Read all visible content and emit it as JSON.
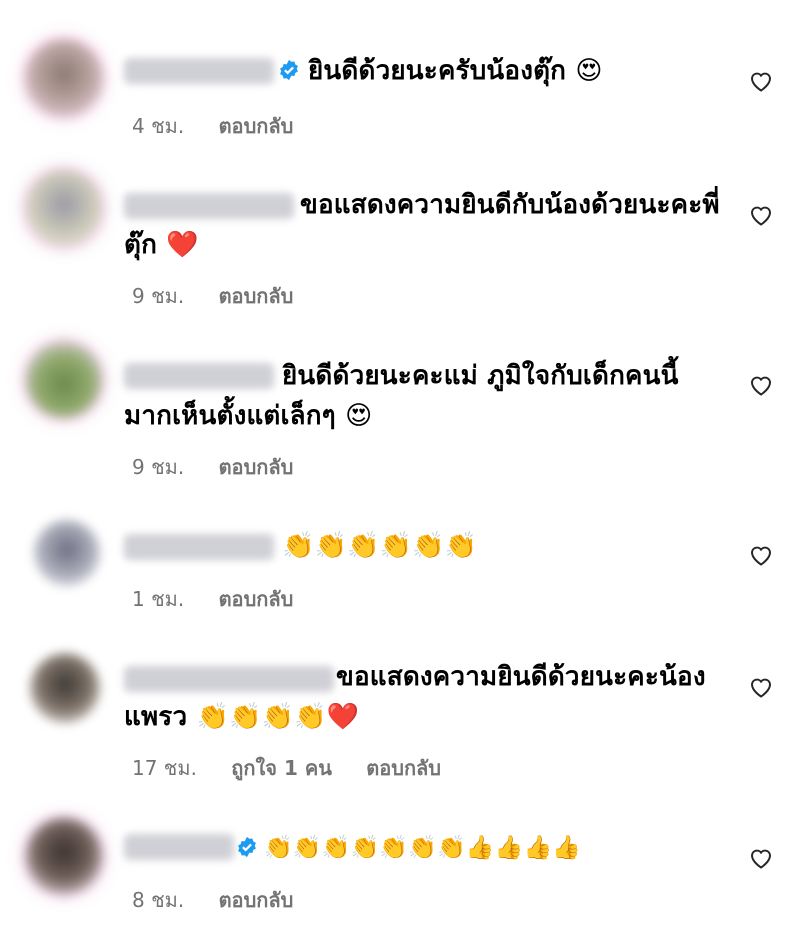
{
  "comments": [
    {
      "text": "ยินดีด้วยนะครับน้องตุ๊ก 😍",
      "time": "4 ชม.",
      "likes": "",
      "reply": "ตอบกลับ"
    },
    {
      "text": "ขอแสดงความยินดีกับน้องด้วยนะคะพี่ตุ๊ก ❤️",
      "time": "9 ชม.",
      "likes": "",
      "reply": "ตอบกลับ"
    },
    {
      "text": "ยินดีด้วยนะคะแม่ ภูมิใจกับเด็กคนนี้มากเห็นตั้งแต่เล็กๆ 😍",
      "time": "9 ชม.",
      "likes": "",
      "reply": "ตอบกลับ"
    },
    {
      "text": "👏👏👏👏👏👏",
      "time": "1 ชม.",
      "likes": "",
      "reply": "ตอบกลับ"
    },
    {
      "text": "ขอแสดงความยินดีด้วยนะคะน้องแพรว 👏👏👏👏❤️",
      "time": "17 ชม.",
      "likes": "ถูกใจ 1 คน",
      "reply": "ตอบกลับ"
    },
    {
      "text": "👏👏👏👏👏👏👏👍👍👍👍",
      "time": "8 ชม.",
      "likes": "",
      "reply": "ตอบกลับ"
    }
  ],
  "icons": {
    "like": "heart-outline-icon",
    "verified": "verified-badge-icon"
  },
  "colors": {
    "verified": "#1d9bf0",
    "meta": "#737373",
    "heart_emoji": "#e8295b"
  }
}
